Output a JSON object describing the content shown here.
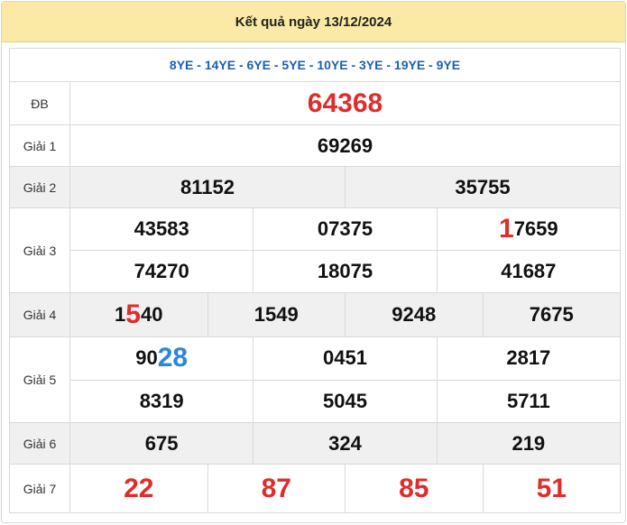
{
  "header": {
    "title": "Kết quả ngày 13/12/2024"
  },
  "codes": "8YE - 14YE - 6YE - 5YE - 10YE - 3YE - 19YE - 9YE",
  "prizes": {
    "db": {
      "label": "ĐB",
      "value": "64368"
    },
    "g1": {
      "label": "Giải 1",
      "values": [
        "69269"
      ]
    },
    "g2": {
      "label": "Giải 2",
      "values": [
        "81152",
        "35755"
      ]
    },
    "g3": {
      "label": "Giải 3",
      "values": [
        "43583",
        "07375",
        "17659",
        "74270",
        "18075",
        "41687"
      ]
    },
    "g4": {
      "label": "Giải 4",
      "values": [
        "1540",
        "1549",
        "9248",
        "7675"
      ]
    },
    "g5": {
      "label": "Giải 5",
      "values": [
        "9028",
        "0451",
        "2817",
        "8319",
        "5045",
        "5711"
      ]
    },
    "g6": {
      "label": "Giải 6",
      "values": [
        "675",
        "324",
        "219"
      ]
    },
    "g7": {
      "label": "Giải 7",
      "values": [
        "22",
        "87",
        "85",
        "51"
      ]
    }
  },
  "highlight_colors": {
    "red": "#e22b2b",
    "blue": "#2b86d9",
    "codes": "#1c5fb5",
    "header_bg": "#fbeaa6"
  }
}
